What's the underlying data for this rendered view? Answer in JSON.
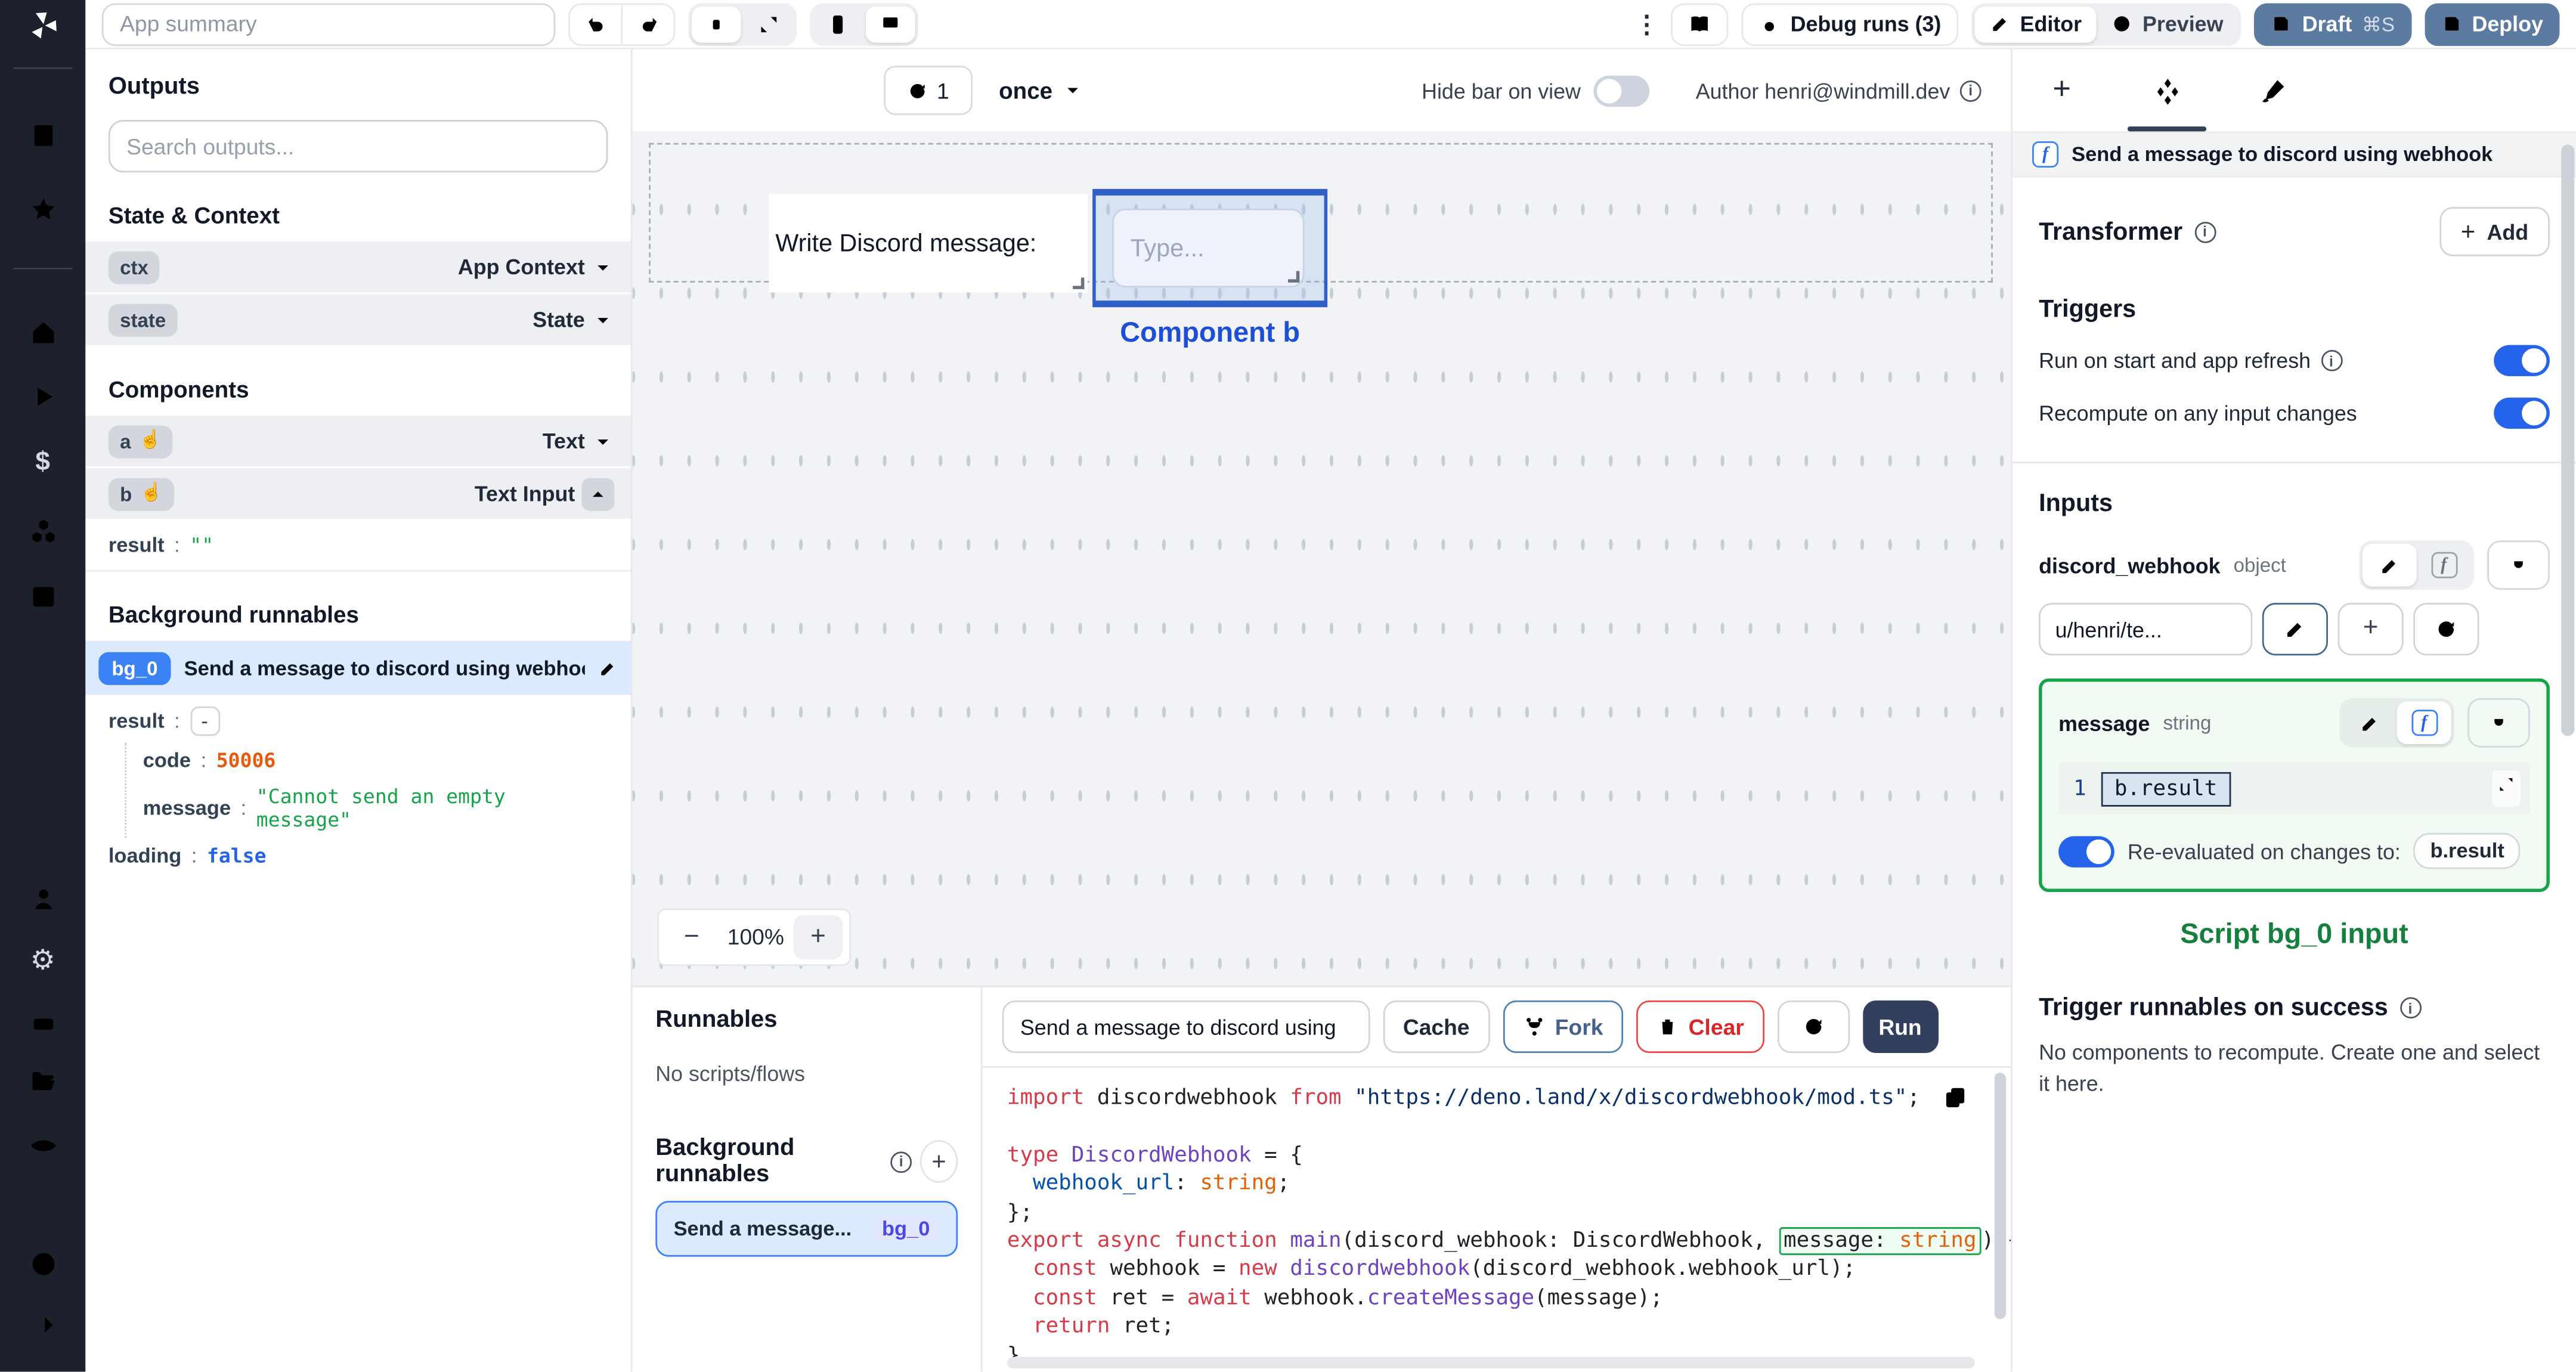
{
  "colors": {
    "accent": "#3b82f6",
    "success": "#16a34a",
    "danger": "#dc2626",
    "draft_button": "#5b7ba1",
    "run_button": "#32405e",
    "selected_component": "#2f5fc7"
  },
  "topbar": {
    "app_summary_placeholder": "App summary",
    "debug_runs_label": "Debug runs (3)",
    "editor_label": "Editor",
    "preview_label": "Preview",
    "draft_label": "Draft",
    "draft_shortcut": "⌘S",
    "deploy_label": "Deploy"
  },
  "outputs": {
    "title": "Outputs",
    "search_placeholder": "Search outputs...",
    "state_context_title": "State & Context",
    "ctx": {
      "key": "ctx",
      "type": "App Context"
    },
    "state": {
      "key": "state",
      "type": "State"
    },
    "components_title": "Components",
    "comp_a": {
      "key": "a",
      "type": "Text"
    },
    "comp_b": {
      "key": "b",
      "type": "Text Input",
      "result_key": "result",
      "result_value": "\"\""
    },
    "background_title": "Background runnables",
    "bg0": {
      "badge": "bg_0",
      "title": "Send a message to discord using webhook",
      "result_key": "result",
      "result_value": "-",
      "code_key": "code",
      "code_value": "50006",
      "message_key": "message",
      "message_value": "\"Cannot send an empty message\"",
      "loading_key": "loading",
      "loading_value": "false"
    }
  },
  "canvas": {
    "refresh_count": "1",
    "frequency": "once",
    "hide_bar_label": "Hide bar on view",
    "author_label": "Author henri@windmill.dev",
    "text_component": "Write Discord message:",
    "input_placeholder": "Type...",
    "selected_component_label": "Component b",
    "zoom_out": "−",
    "zoom_level": "100%",
    "zoom_in": "+"
  },
  "runnables": {
    "title": "Runnables",
    "empty_label": "No scripts/flows",
    "background_title": "Background runnables",
    "item": {
      "title": "Send a message...",
      "badge": "bg_0"
    }
  },
  "editor": {
    "script_name": "Send a message to discord using",
    "cache_label": "Cache",
    "fork_label": "Fork",
    "clear_label": "Clear",
    "run_label": "Run",
    "code_lines": [
      [
        {
          "t": "import",
          "c": "kw"
        },
        {
          "t": " discordwebhook ",
          "c": "pl"
        },
        {
          "t": "from",
          "c": "kw"
        },
        {
          "t": " ",
          "c": "pl"
        },
        {
          "t": "\"https://deno.land/x/discordwebhook/mod.ts\"",
          "c": "str"
        },
        {
          "t": ";",
          "c": "pl"
        }
      ],
      [],
      [
        {
          "t": "type",
          "c": "kw"
        },
        {
          "t": " ",
          "c": "pl"
        },
        {
          "t": "DiscordWebhook",
          "c": "typ"
        },
        {
          "t": " = {",
          "c": "pl"
        }
      ],
      [
        {
          "t": "  ",
          "c": "pl"
        },
        {
          "t": "webhook_url",
          "c": "prop"
        },
        {
          "t": ": ",
          "c": "pl"
        },
        {
          "t": "string",
          "c": "orange"
        },
        {
          "t": ";",
          "c": "pl"
        }
      ],
      [
        {
          "t": "};",
          "c": "pl"
        }
      ],
      [
        {
          "t": "export",
          "c": "kw"
        },
        {
          "t": " ",
          "c": "pl"
        },
        {
          "t": "async",
          "c": "kw"
        },
        {
          "t": " ",
          "c": "pl"
        },
        {
          "t": "function",
          "c": "kw"
        },
        {
          "t": " ",
          "c": "pl"
        },
        {
          "t": "main",
          "c": "fn"
        },
        {
          "t": "(discord_webhook: DiscordWebhook, ",
          "c": "pl"
        },
        {
          "t": "message: ",
          "c": "pl",
          "b": 1
        },
        {
          "t": "string",
          "c": "orange",
          "b": 1
        },
        {
          "t": ") {",
          "c": "pl"
        }
      ],
      [
        {
          "t": "  ",
          "c": "pl"
        },
        {
          "t": "const",
          "c": "kw"
        },
        {
          "t": " webhook = ",
          "c": "pl"
        },
        {
          "t": "new",
          "c": "kw"
        },
        {
          "t": " ",
          "c": "pl"
        },
        {
          "t": "discordwebhook",
          "c": "fn"
        },
        {
          "t": "(discord_webhook.webhook_url);",
          "c": "pl"
        }
      ],
      [
        {
          "t": "  ",
          "c": "pl"
        },
        {
          "t": "const",
          "c": "kw"
        },
        {
          "t": " ret = ",
          "c": "pl"
        },
        {
          "t": "await",
          "c": "kw"
        },
        {
          "t": " webhook.",
          "c": "pl"
        },
        {
          "t": "createMessage",
          "c": "fn"
        },
        {
          "t": "(message);",
          "c": "pl"
        }
      ],
      [
        {
          "t": "  ",
          "c": "pl"
        },
        {
          "t": "return",
          "c": "kw"
        },
        {
          "t": " ret;",
          "c": "pl"
        }
      ],
      [
        {
          "t": "}",
          "c": "pl"
        }
      ]
    ]
  },
  "inspector": {
    "title": "Send a message to discord using webhook",
    "transformer_label": "Transformer",
    "add_plus": "+",
    "add_label": "Add",
    "triggers_title": "Triggers",
    "run_on_start_label": "Run on start and app refresh",
    "recompute_label": "Recompute on any input changes",
    "inputs_title": "Inputs",
    "discord_webhook": {
      "name": "discord_webhook",
      "type": "object",
      "value": "u/henri/te..."
    },
    "message": {
      "name": "message",
      "type": "string",
      "line_number": "1",
      "expression": "b.result",
      "reeval_label": "Re-evaluated on changes to:",
      "reeval_target": "b.result"
    },
    "script_input_label": "Script bg_0 input",
    "trigger_success_title": "Trigger runnables on success",
    "empty_text": "No components to recompute. Create one and select it here."
  }
}
